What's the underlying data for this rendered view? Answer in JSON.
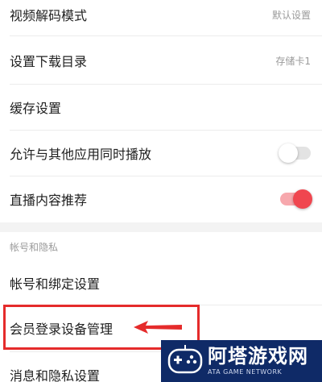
{
  "settings": {
    "items": [
      {
        "label": "视频解码模式",
        "value": "默认设置"
      },
      {
        "label": "设置下载目录",
        "value": "存储卡1"
      },
      {
        "label": "缓存设置"
      },
      {
        "label": "允许与其他应用同时播放",
        "toggle": false
      },
      {
        "label": "直播内容推荐",
        "toggle": true
      }
    ],
    "account_section": {
      "header": "帐号和隐私",
      "items": [
        {
          "label": "帐号和绑定设置"
        },
        {
          "label": "会员登录设备管理"
        },
        {
          "label": "消息和隐私设置"
        }
      ]
    }
  },
  "colors": {
    "toggle_on_knob": "#f0464f",
    "toggle_on_track": "#f7a8ad",
    "toggle_off_track": "#e3e3e3",
    "annotation_red": "#e52b2b",
    "watermark_bg": "#0f2a67"
  },
  "annotation": {
    "highlight_target": "会员登录设备管理",
    "arrow_direction": "left"
  },
  "watermark": {
    "title": "阿塔游戏网",
    "subtitle": "ATA GAME NETWORK",
    "icon": "gamepad-logo-icon"
  }
}
